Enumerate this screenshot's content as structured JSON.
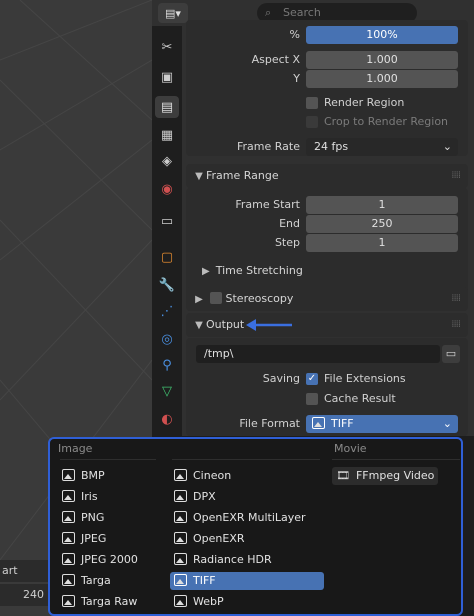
{
  "viewport": {
    "frame_label": "art",
    "frame_value": "240"
  },
  "header": {
    "search_placeholder": "Search"
  },
  "tabs": [
    {
      "icon": "tool-icon"
    },
    {
      "icon": "render-icon"
    },
    {
      "icon": "output-icon"
    },
    {
      "icon": "view-layer-icon"
    },
    {
      "icon": "scene-icon"
    },
    {
      "icon": "world-icon"
    },
    {
      "icon": "collection-icon"
    },
    {
      "icon": "object-icon"
    },
    {
      "icon": "modifier-icon"
    },
    {
      "icon": "particles-icon"
    },
    {
      "icon": "physics-icon"
    },
    {
      "icon": "constraints-icon"
    },
    {
      "icon": "data-icon"
    },
    {
      "icon": "material-icon"
    }
  ],
  "format": {
    "percent_label": "%",
    "percent_value": "100%",
    "aspect_x_label": "Aspect X",
    "aspect_x_value": "1.000",
    "aspect_y_label": "Y",
    "aspect_y_value": "1.000",
    "render_region": "Render Region",
    "crop_region": "Crop to Render Region",
    "frame_rate_label": "Frame Rate",
    "frame_rate_value": "24 fps"
  },
  "frame_range": {
    "title": "Frame Range",
    "start_label": "Frame Start",
    "start_value": "1",
    "end_label": "End",
    "end_value": "250",
    "step_label": "Step",
    "step_value": "1",
    "time_stretching": "Time Stretching"
  },
  "stereoscopy": {
    "title": "Stereoscopy"
  },
  "output": {
    "title": "Output",
    "path": "/tmp\\",
    "saving_label": "Saving",
    "file_extensions": "File Extensions",
    "cache_result": "Cache Result",
    "file_format_label": "File Format",
    "file_format_value": "TIFF"
  },
  "dropdown": {
    "image_title": "Image",
    "movie_title": "Movie",
    "col1": [
      "BMP",
      "Iris",
      "PNG",
      "JPEG",
      "JPEG 2000",
      "Targa",
      "Targa Raw"
    ],
    "col2": [
      "Cineon",
      "DPX",
      "OpenEXR MultiLayer",
      "OpenEXR",
      "Radiance HDR",
      "TIFF",
      "WebP"
    ],
    "movie": [
      "FFmpeg Video"
    ],
    "selected": "TIFF"
  },
  "colors": {
    "accent": "#4772b3",
    "highlight_border": "#2f5fd6",
    "annotation_arrow": "#3a6fe0"
  }
}
